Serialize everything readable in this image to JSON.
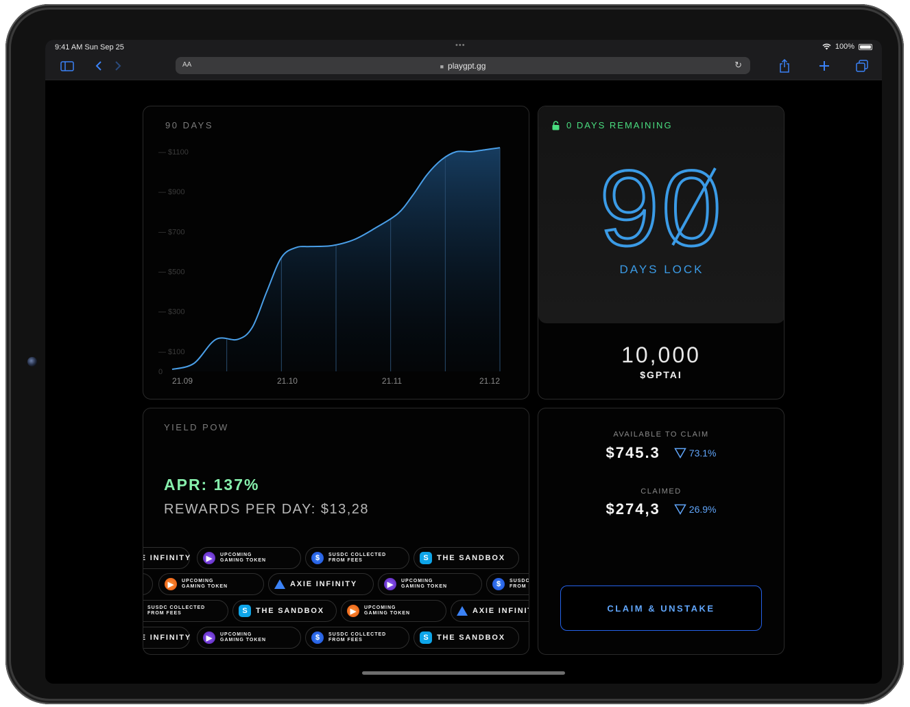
{
  "status": {
    "time": "9:41 AM  Sun Sep 25",
    "dots": "•••",
    "battery": "100%"
  },
  "browser": {
    "aa": "AA",
    "url": "playgpt.gg"
  },
  "chart_panel": {
    "title": "90 DAYS"
  },
  "chart_data": {
    "type": "area",
    "x_ticks": [
      "21.09",
      "21.10",
      "21.11",
      "21.12"
    ],
    "y_ticks": [
      "0",
      "$100",
      "$300",
      "$500",
      "$700",
      "$900",
      "$1100"
    ],
    "y_tick_values": [
      0,
      100,
      300,
      500,
      700,
      900,
      1100
    ],
    "ylim": [
      0,
      1100
    ],
    "xlim": [
      0,
      90
    ],
    "x": [
      0,
      6,
      12,
      18,
      22,
      26,
      30,
      34,
      38,
      44,
      50,
      56,
      62,
      66,
      70,
      74,
      78,
      82,
      86,
      90
    ],
    "values": [
      10,
      40,
      160,
      160,
      220,
      400,
      570,
      620,
      625,
      630,
      660,
      720,
      790,
      880,
      985,
      1060,
      1100,
      1100,
      1110,
      1120
    ],
    "line_color": "#4a9fe8",
    "grid": false
  },
  "lock": {
    "remaining": "0 DAYS REMAINING",
    "big_number": "90",
    "caption": "DAYS LOCK",
    "amount": "10,000",
    "token": "$GPTAI",
    "accent_green": "#4ade80",
    "accent_blue": "#3b9be6"
  },
  "yield": {
    "title": "YIELD POW",
    "apr": "APR: 137%",
    "rewards": "REWARDS PER DAY: $13,28",
    "pills": {
      "axie": "AXIE INFINITY",
      "gaming_1": "UPCOMING",
      "gaming_2": "GAMING TOKEN",
      "susdc_1": "SUSDC COLLECTED",
      "susdc_2": "FROM FEES",
      "sandbox": "THE SANDBOX"
    },
    "icons": {
      "gaming": "play-triangle-icon",
      "susdc": "dollar-coin-icon",
      "sandbox": "sandbox-s-icon",
      "axie": "axie-diamond-icon"
    }
  },
  "claim": {
    "available_label": "AVAILABLE TO CLAIM",
    "available_value": "$745.3",
    "available_pct": "73.1%",
    "claimed_label": "CLAIMED",
    "claimed_value": "$274,3",
    "claimed_pct": "26.9%",
    "button": "CLAIM & UNSTAKE"
  }
}
